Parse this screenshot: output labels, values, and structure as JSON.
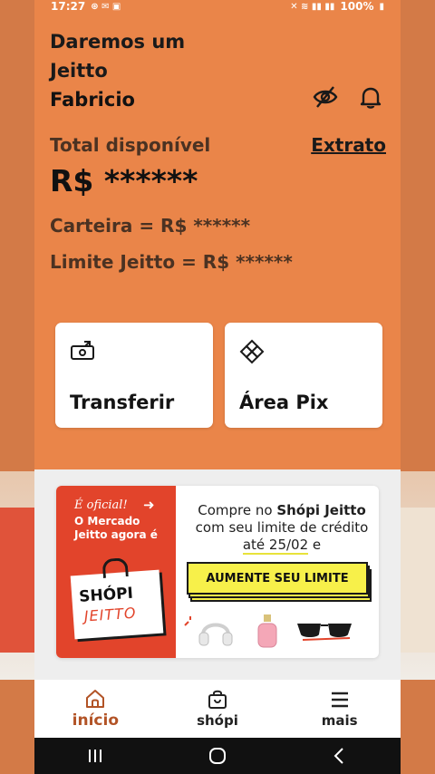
{
  "status": {
    "time": "17:27",
    "battery": "100%"
  },
  "greeting": {
    "line1": "Daremos um",
    "line2": "Jeitto",
    "name": "Fabricio"
  },
  "balance": {
    "total_label": "Total disponível",
    "extrato": "Extrato",
    "amount": "R$ ******",
    "wallet": "Carteira = R$ ******",
    "limit": "Limite Jeitto = R$ ******"
  },
  "actions": [
    {
      "label": "Transferir",
      "icon": "transfer-icon"
    },
    {
      "label": "Área Pix",
      "icon": "pix-icon"
    }
  ],
  "banner": {
    "official": "É oficial!",
    "subtitle": "O Mercado Jeitto agora é",
    "bag_line1": "SHÓPI",
    "bag_line2": "JEITTO",
    "text_1": "Compre no ",
    "text_brand": "Shópi Jeitto",
    "text_2": " com seu limite de crédito ",
    "text_date": "até 25/02",
    "text_3": " e",
    "cta": "AUMENTE SEU LIMITE"
  },
  "nav": [
    {
      "label": "início",
      "icon": "home-icon",
      "active": true
    },
    {
      "label": "shópi",
      "icon": "shop-bag-icon",
      "active": false
    },
    {
      "label": "mais",
      "icon": "menu-icon",
      "active": false
    }
  ],
  "colors": {
    "accent": "#ea8549",
    "active_nav": "#b25326",
    "banner_red": "#e2442b",
    "cta_yellow": "#f7f04a"
  }
}
